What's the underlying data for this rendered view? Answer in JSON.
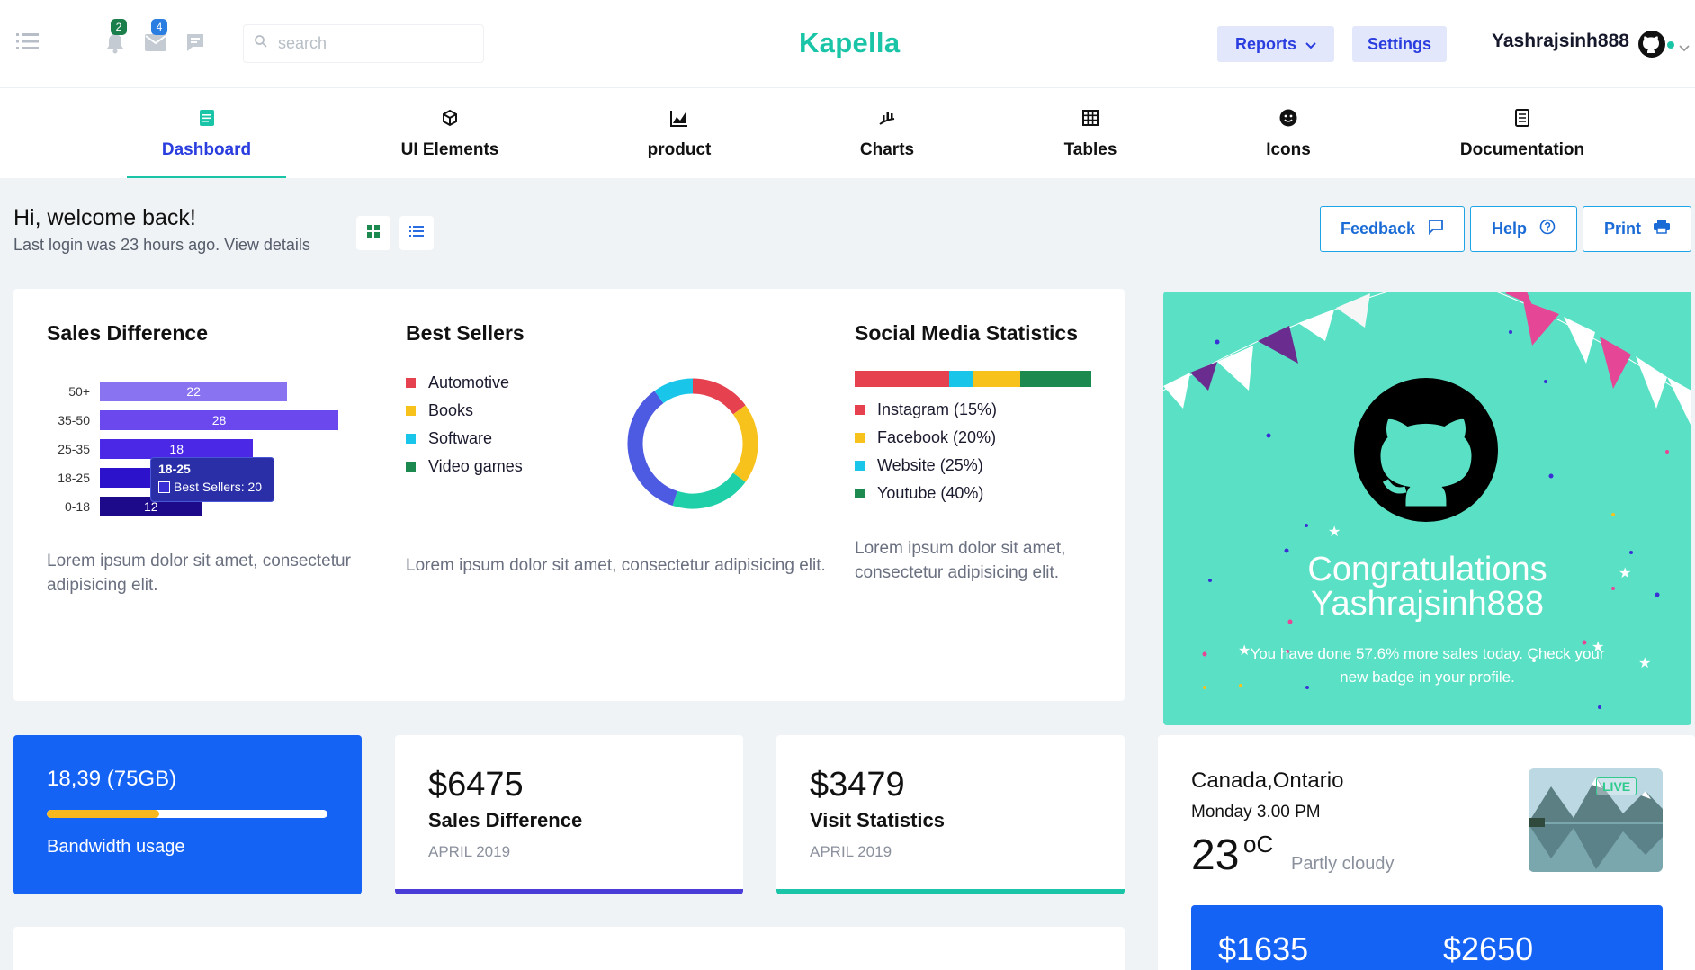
{
  "header": {
    "notifications_count": "2",
    "messages_count": "4",
    "search_placeholder": "search",
    "brand": "Kapella",
    "reports_label": "Reports",
    "settings_label": "Settings",
    "username": "Yashrajsinh888",
    "badge_color_notifications": "#1a7f4b",
    "badge_color_messages": "#2a7de1"
  },
  "nav": {
    "items": [
      {
        "label": "Dashboard",
        "icon": "document-icon",
        "active": true
      },
      {
        "label": "UI Elements",
        "icon": "cube-icon"
      },
      {
        "label": "product",
        "icon": "area-chart-icon"
      },
      {
        "label": "Charts",
        "icon": "bar-chart-icon"
      },
      {
        "label": "Tables",
        "icon": "grid-icon"
      },
      {
        "label": "Icons",
        "icon": "smiley-icon"
      },
      {
        "label": "Documentation",
        "icon": "file-text-icon"
      }
    ]
  },
  "welcome": {
    "title": "Hi, welcome back!",
    "subtitle": "Last login was 23 hours ago. View details",
    "feedback_label": "Feedback",
    "help_label": "Help",
    "print_label": "Print"
  },
  "sales_difference": {
    "title": "Sales Difference",
    "description": "Lorem ipsum dolor sit amet, consectetur adipisicing elit.",
    "tooltip_title": "18-25",
    "tooltip_value": "Best Sellers: 20"
  },
  "best_sellers": {
    "title": "Best Sellers",
    "description": "Lorem ipsum dolor sit amet, consectetur adipisicing elit.",
    "legend": [
      {
        "label": "Automotive",
        "color": "#e5414f"
      },
      {
        "label": "Books",
        "color": "#f8c21d"
      },
      {
        "label": "Software",
        "color": "#19c5e8"
      },
      {
        "label": "Video games",
        "color": "#1c8a4f"
      }
    ]
  },
  "social_media": {
    "title": "Social Media Statistics",
    "description": "Lorem ipsum dolor sit amet, consectetur adipisicing elit.",
    "legend": [
      {
        "label": "Instagram (15%)",
        "color": "#e5414f"
      },
      {
        "label": "Facebook (20%)",
        "color": "#f8c21d"
      },
      {
        "label": "Website (25%)",
        "color": "#19c5e8"
      },
      {
        "label": "Youtube (40%)",
        "color": "#1c8a4f"
      }
    ]
  },
  "congrats": {
    "title_line1": "Congratulations",
    "title_line2": "Yashrajsinh888",
    "message": "You have done 57.6% more sales today. Check your new badge in your profile."
  },
  "bandwidth": {
    "value": "18,39 (75GB)",
    "label": "Bandwidth usage",
    "progress": 0.4
  },
  "stat_sales": {
    "amount": "$6475",
    "label": "Sales Difference",
    "date": "APRIL 2019",
    "accent": "#4a3cd6"
  },
  "stat_visits": {
    "amount": "$3479",
    "label": "Visit Statistics",
    "date": "APRIL 2019",
    "accent": "#1ac5a7"
  },
  "weather": {
    "location": "Canada,Ontario",
    "time": "Monday 3.00 PM",
    "temperature": "23",
    "unit": "oC",
    "description": "Partly cloudy",
    "live_label": "LIVE",
    "amount1": "$1635",
    "amount2": "$2650"
  },
  "chart_data": [
    {
      "type": "bar",
      "orientation": "horizontal",
      "categories": [
        "50+",
        "35-50",
        "25-35",
        "18-25",
        "0-18"
      ],
      "values": [
        22,
        28,
        18,
        20,
        12
      ],
      "labels": [
        "22",
        "28",
        "18",
        "",
        "12"
      ],
      "colors": [
        "#8a73f0",
        "#6a48ee",
        "#4a28e6",
        "#2d12cc",
        "#1d0a8a"
      ],
      "xlim": [
        0,
        30
      ]
    },
    {
      "type": "pie",
      "variant": "doughnut",
      "labels": [
        "Automotive",
        "Books",
        "Software",
        "Video games"
      ],
      "values": [
        15,
        20,
        25,
        40
      ],
      "colors": [
        "#e5414f",
        "#f8c21d",
        "#19c5e8",
        "#1c8a4f"
      ],
      "segment_colors_as_drawn": [
        "#e5414f",
        "#f8c21d",
        "#1ecfa8",
        "#4d5ae2",
        "#19c5e8"
      ],
      "segment_values_as_drawn": [
        15,
        20,
        20,
        35,
        10
      ]
    },
    {
      "type": "bar",
      "orientation": "stacked-horizontal",
      "categories": [
        "Instagram",
        "Facebook",
        "Website",
        "Youtube"
      ],
      "values": [
        15,
        20,
        25,
        40
      ],
      "colors": [
        "#e5414f",
        "#19c5e8",
        "#f8c21d",
        "#1c8a4f"
      ],
      "segment_widths_as_drawn": [
        40,
        10,
        20,
        30
      ]
    }
  ]
}
